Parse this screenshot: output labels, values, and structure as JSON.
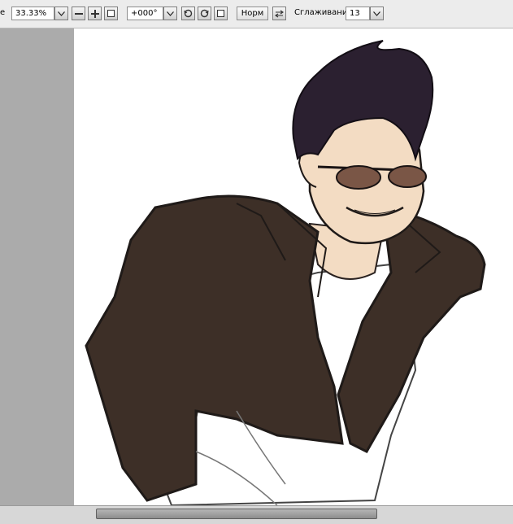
{
  "toolbar": {
    "cutoff_label": "е",
    "zoom_value": "33.33%",
    "rotation_value": "+000°",
    "blend_mode_label": "Норм",
    "smoothing_label": "Сглаживание",
    "smoothing_value": "13"
  },
  "icons": {
    "zoom_dropdown": "chevron-down-icon",
    "zoom_out": "zoom-out-icon",
    "zoom_in": "zoom-in-icon",
    "fit": "fit-window-icon",
    "rotation_dropdown": "chevron-down-icon",
    "rotate_left": "rotate-left-icon",
    "rotate_right": "rotate-right-icon",
    "reset_rotation": "reset-rotation-icon",
    "flip": "flip-horizontal-icon",
    "smoothing_dropdown": "chevron-down-icon"
  },
  "colors": {
    "workspace_bg": "#ababab",
    "toolbar_bg": "#ececec",
    "canvas_bg": "#ffffff",
    "jacket": "#3d2f27",
    "hair": "#2b2030",
    "skin": "#f3dcc3",
    "lens": "#7a5646",
    "shirt": "#ffffff",
    "line_art": "#1f1a18"
  }
}
